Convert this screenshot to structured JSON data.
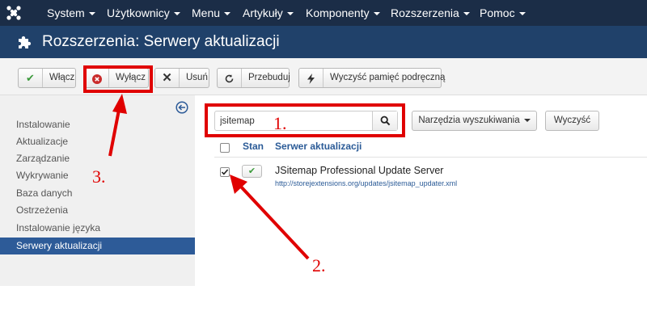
{
  "navbar": {
    "logo_icon": "joomla-logo-icon",
    "items": [
      {
        "label": "System"
      },
      {
        "label": "Użytkownicy"
      },
      {
        "label": "Menu"
      },
      {
        "label": "Artykuły"
      },
      {
        "label": "Komponenty"
      },
      {
        "label": "Rozszerzenia"
      },
      {
        "label": "Pomoc"
      }
    ]
  },
  "header": {
    "icon": "puzzle-icon",
    "title": "Rozszerzenia: Serwery aktualizacji"
  },
  "toolbar": {
    "buttons": [
      {
        "label": "Włącz",
        "icon": "check-icon",
        "icon_color": "#3c9a3c"
      },
      {
        "label": "Wyłącz",
        "icon": "disable-circle-icon",
        "icon_color": "#c92b2b"
      },
      {
        "label": "Usuń",
        "icon": "x-icon",
        "icon_color": "#333333"
      },
      {
        "label": "Przebuduj",
        "icon": "refresh-icon",
        "icon_color": "#333333"
      },
      {
        "label": "Wyczyść pamięć podręczną",
        "icon": "flash-icon",
        "icon_color": "#333333"
      }
    ]
  },
  "sidebar": {
    "collapse_icon": "arrow-left-circle-icon",
    "items": [
      {
        "label": "Instalowanie",
        "active": false
      },
      {
        "label": "Aktualizacje",
        "active": false
      },
      {
        "label": "Zarządzanie",
        "active": false
      },
      {
        "label": "Wykrywanie",
        "active": false
      },
      {
        "label": "Baza danych",
        "active": false
      },
      {
        "label": "Ostrzeżenia",
        "active": false
      },
      {
        "label": "Instalowanie języka",
        "active": false
      },
      {
        "label": "Serwery aktualizacji",
        "active": true
      }
    ]
  },
  "search": {
    "value": "jsitemap",
    "button_icon": "search-icon",
    "tools_label": "Narzędzia wyszukiwania",
    "clear_label": "Wyczyść"
  },
  "table": {
    "headers": {
      "state": "Stan",
      "server": "Serwer aktualizacji"
    },
    "rows": [
      {
        "checked": true,
        "state_icon": "check-icon",
        "name": "JSitemap Professional Update Server",
        "url": "http://storejextensions.org/updates/jsitemap_updater.xml"
      }
    ]
  },
  "annotations": {
    "color": "#e00000",
    "labels": [
      "1.",
      "2.",
      "3."
    ]
  }
}
